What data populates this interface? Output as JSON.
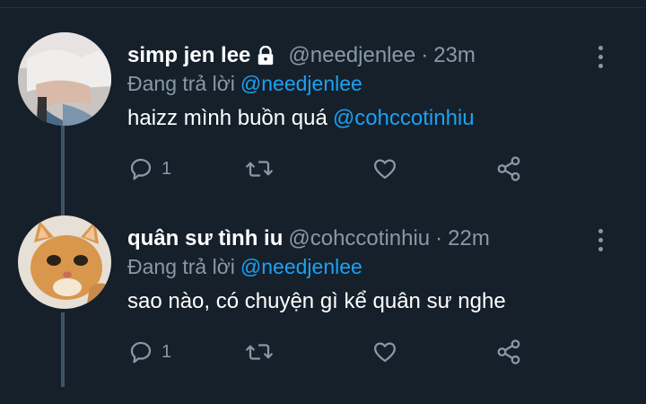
{
  "tweets": [
    {
      "display_name": "simp jen lee",
      "protected": true,
      "handle": "@needjenlee",
      "separator": "·",
      "time": "23m",
      "replying_label": "Đang trả lời",
      "replying_to": "@needjenlee",
      "text": "haizz mình buồn quá",
      "text_mention": "@cohccotinhiu",
      "reply_count": "1",
      "avatar_icon": "photo-avatar-icon"
    },
    {
      "display_name": "quân sư tình iu",
      "protected": false,
      "handle": "@cohccotinhiu",
      "separator": "·",
      "time": "22m",
      "replying_label": "Đang trả lời",
      "replying_to": "@needjenlee",
      "text": "sao nào, có chuyện gì kể quân sư nghe",
      "text_mention": "",
      "reply_count": "1",
      "avatar_icon": "cat-avatar-icon"
    }
  ],
  "colors": {
    "background": "#15202b",
    "secondary_text": "#8899a6",
    "link": "#1da1f2",
    "thread_line": "#3d5466"
  },
  "icons": [
    "lock-icon",
    "more-icon",
    "reply-icon",
    "retweet-icon",
    "like-icon",
    "share-icon"
  ]
}
